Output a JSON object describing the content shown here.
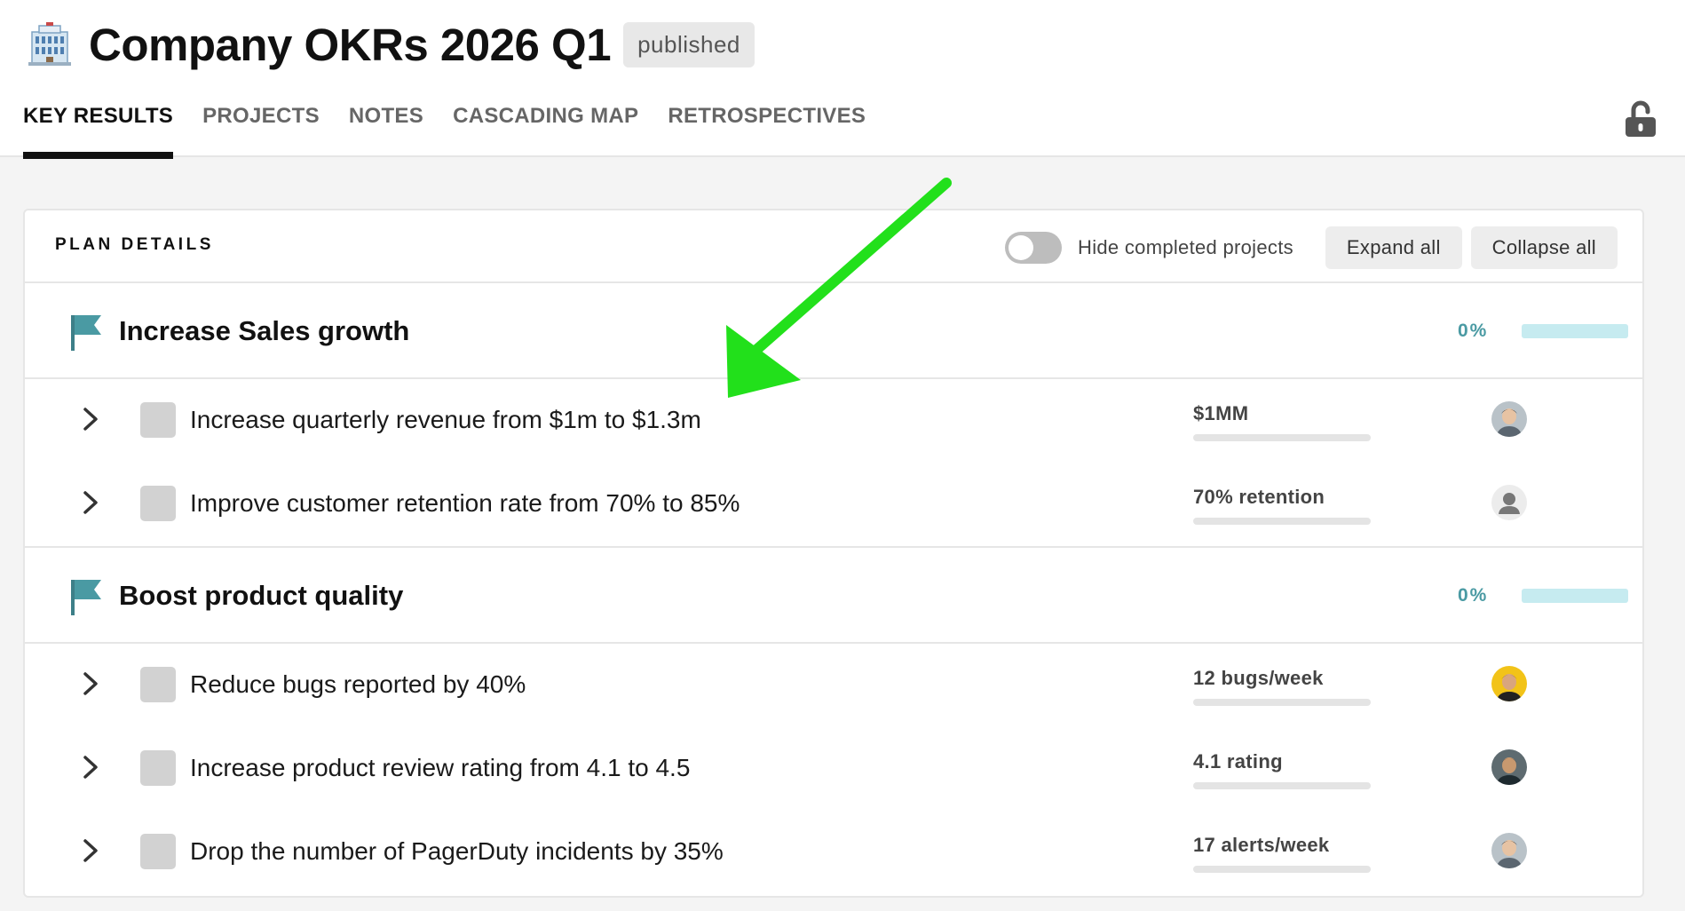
{
  "header": {
    "title": "Company OKRs 2026 Q1",
    "status": "published",
    "icon": "office-building-icon"
  },
  "tabs": [
    {
      "label": "KEY RESULTS",
      "active": true
    },
    {
      "label": "PROJECTS",
      "active": false
    },
    {
      "label": "NOTES",
      "active": false
    },
    {
      "label": "CASCADING MAP",
      "active": false
    },
    {
      "label": "RETROSPECTIVES",
      "active": false
    }
  ],
  "panel": {
    "title": "PLAN DETAILS",
    "toggle_label": "Hide completed projects",
    "toggle_on": false,
    "expand_label": "Expand all",
    "collapse_label": "Collapse all"
  },
  "objectives": [
    {
      "title": "Increase Sales growth",
      "progress_label": "0%",
      "progress": 0,
      "key_results": [
        {
          "title": "Increase quarterly revenue from $1m to $1.3m",
          "metric": "$1MM",
          "progress": 0,
          "avatar": "photo-avatar-1"
        },
        {
          "title": "Improve customer retention rate from 70% to 85%",
          "metric": "70% retention",
          "progress": 0,
          "avatar": "placeholder-avatar"
        }
      ]
    },
    {
      "title": "Boost product quality",
      "progress_label": "0%",
      "progress": 0,
      "key_results": [
        {
          "title": "Reduce bugs reported by 40%",
          "metric": "12 bugs/week",
          "progress": 0,
          "avatar": "photo-avatar-2"
        },
        {
          "title": "Increase product review rating from 4.1 to 4.5",
          "metric": "4.1 rating",
          "progress": 0,
          "avatar": "photo-avatar-3"
        },
        {
          "title": "Drop the number of PagerDuty incidents by 35%",
          "metric": "17 alerts/week",
          "progress": 0,
          "avatar": "photo-avatar-1"
        }
      ]
    }
  ],
  "colors": {
    "accent": "#4a9aa3",
    "accent_light": "#c6ebf0",
    "annotation_arrow": "#22e01b"
  },
  "annotation": "green-arrow-pointing-to-first-key-result"
}
